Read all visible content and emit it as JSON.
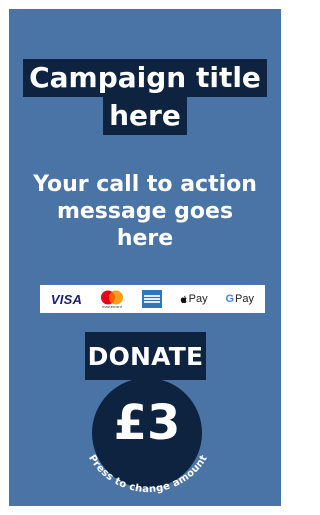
{
  "campaign": {
    "title_lines": [
      "Campaign title",
      "here"
    ],
    "cta_lines": [
      "Your call to action",
      "message goes",
      "here"
    ]
  },
  "payments": {
    "visa": "VISA",
    "mastercard_label": "mastercard",
    "apple_pay": "Pay",
    "google_pay": "Pay",
    "google_g": "G"
  },
  "donate": {
    "label": "DONATE",
    "amount": "£3",
    "hint": "Press to change amount"
  },
  "colors": {
    "panel": "#4a73a6",
    "navy": "#0e2340",
    "text": "#ffffff"
  }
}
